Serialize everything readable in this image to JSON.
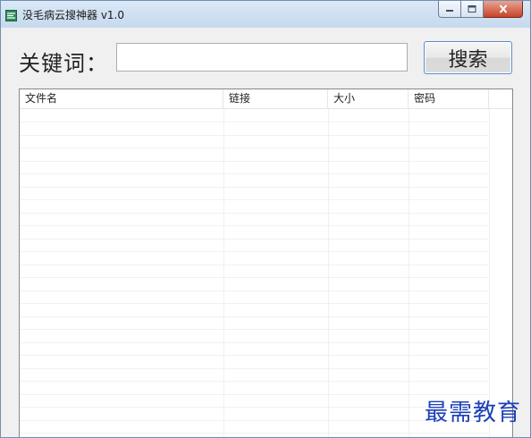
{
  "window": {
    "title": "没毛病云搜神器 v1.0",
    "controls": {
      "minimize_icon": "minimize-icon",
      "maximize_icon": "maximize-icon",
      "close_icon": "close-icon"
    }
  },
  "search": {
    "label": "关键词：",
    "input_value": "",
    "button_label": "搜索"
  },
  "results": {
    "columns": [
      "文件名",
      "链接",
      "大小",
      "密码"
    ],
    "rows": []
  },
  "watermark": "最需教育",
  "colors": {
    "title_bar": "#c6d9ee",
    "button_border": "#5a8ec9",
    "close_button": "#c7432a",
    "watermark": "#1d3fb8"
  }
}
